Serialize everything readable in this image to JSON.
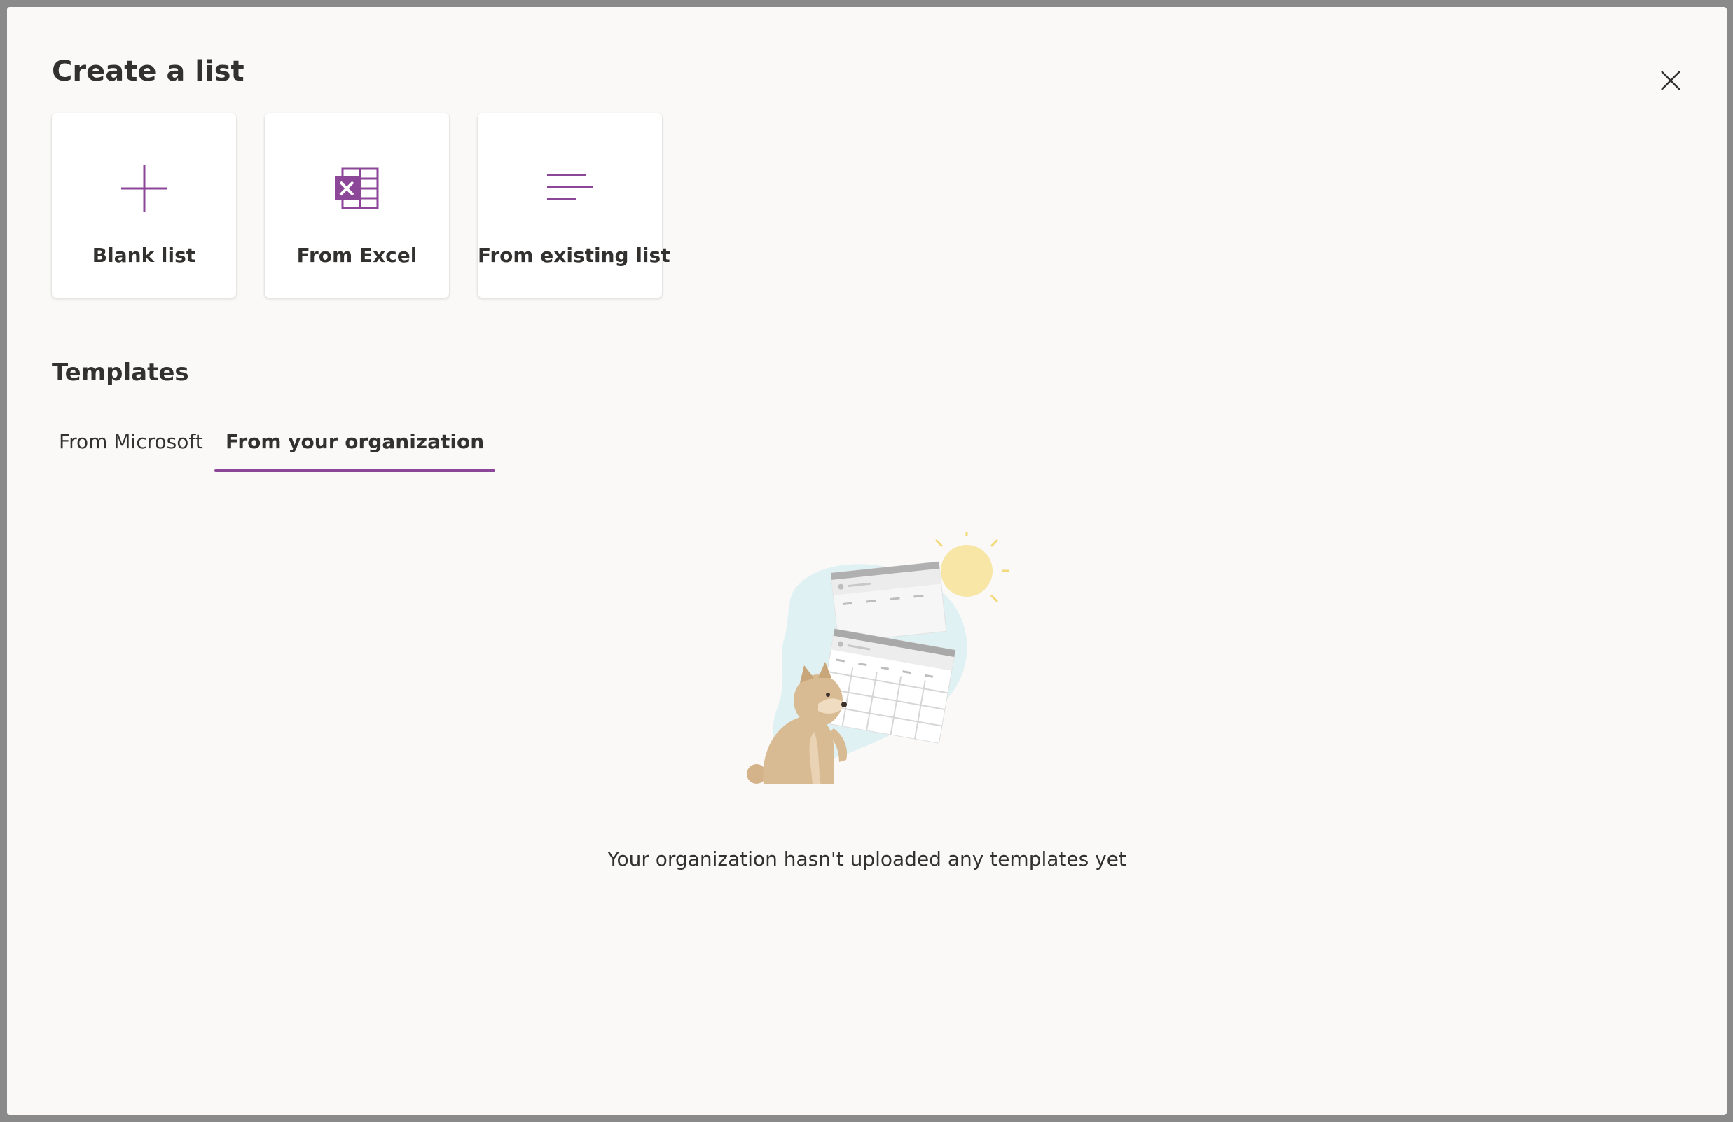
{
  "dialog": {
    "title": "Create a list",
    "close_icon": "close-icon"
  },
  "create_options": [
    {
      "label": "Blank list",
      "icon": "plus-icon"
    },
    {
      "label": "From Excel",
      "icon": "excel-icon"
    },
    {
      "label": "From existing list",
      "icon": "list-lines-icon"
    }
  ],
  "templates": {
    "title": "Templates",
    "tabs": [
      {
        "label": "From Microsoft",
        "selected": false
      },
      {
        "label": "From your organization",
        "selected": true
      }
    ],
    "empty_message": "Your organization hasn't uploaded any templates yet"
  },
  "colors": {
    "accent": "#8c4799",
    "background": "#faf9f8",
    "text": "#323130"
  }
}
